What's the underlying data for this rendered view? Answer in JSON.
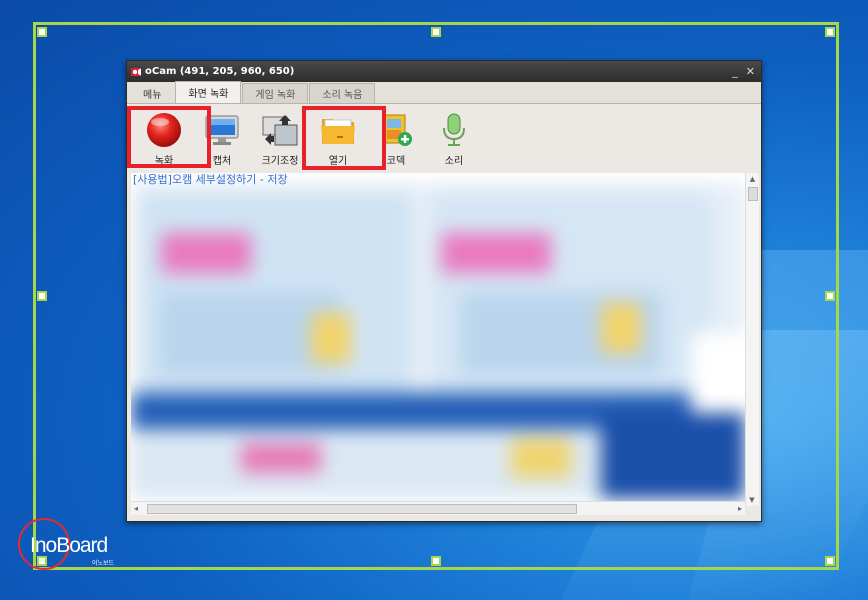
{
  "window": {
    "title": "oCam (491, 205, 960, 650)",
    "minimize": "_",
    "close": "✕"
  },
  "tabs": [
    {
      "label": "메뉴"
    },
    {
      "label": "화면 녹화"
    },
    {
      "label": "게임 녹화"
    },
    {
      "label": "소리 녹음"
    }
  ],
  "toolbar": {
    "record": "녹화",
    "capture": "캡처",
    "resize": "크기조정",
    "open": "열기",
    "codec": "코덱",
    "sound": "소리"
  },
  "content": {
    "link_text": "[사용법]오캠 세부설정하기 - 저장"
  },
  "logo": {
    "name": "InoBoard",
    "sub": "이노보드"
  },
  "colors": {
    "frame": "#a6d64a",
    "highlight": "#e8212b"
  }
}
